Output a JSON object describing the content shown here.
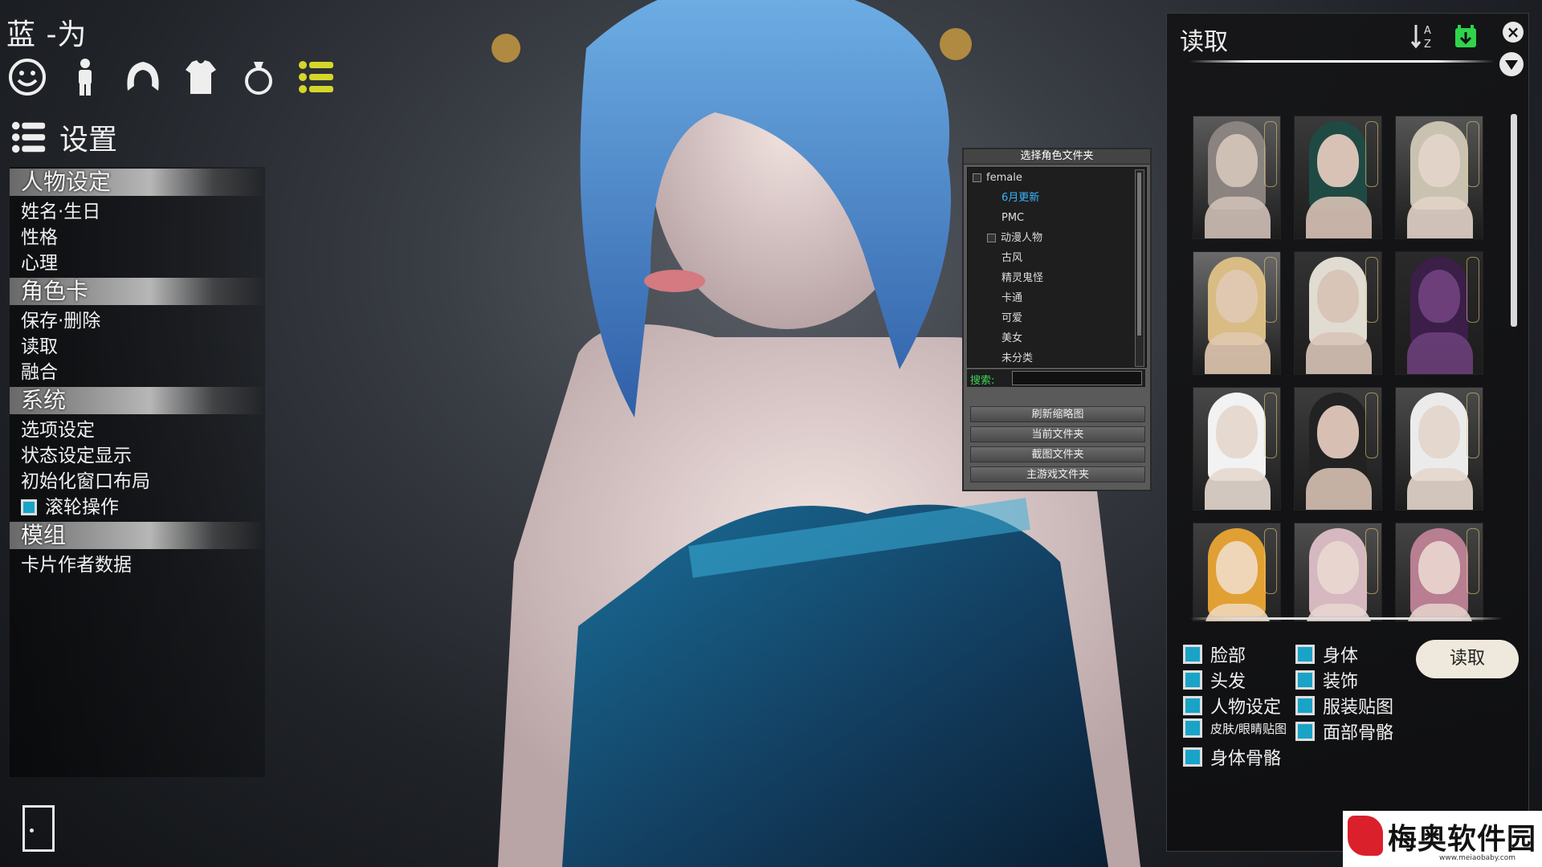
{
  "header": {
    "character_name": "蓝 -为",
    "categories": [
      {
        "name": "face-icon"
      },
      {
        "name": "body-icon"
      },
      {
        "name": "hair-icon"
      },
      {
        "name": "clothes-icon"
      },
      {
        "name": "accessory-icon"
      },
      {
        "name": "list-menu-icon",
        "active_color": "#d6d62a"
      }
    ],
    "settings_label": "设置"
  },
  "left_menu": {
    "sections": [
      {
        "title": "人物设定",
        "items": [
          "姓名·生日",
          "性格",
          "心理"
        ]
      },
      {
        "title": "角色卡",
        "items": [
          "保存·删除",
          "读取",
          "融合"
        ]
      },
      {
        "title": "系统",
        "items": [
          "选项设定",
          "状态设定显示",
          "初始化窗口布局"
        ],
        "checkbox_item": "滚轮操作"
      },
      {
        "title": "模组",
        "items": [
          "卡片作者数据"
        ]
      }
    ]
  },
  "folder_panel": {
    "title": "选择角色文件夹",
    "tree": [
      {
        "label": "female",
        "indent": 0,
        "expander": true
      },
      {
        "label": "6月更新",
        "indent": 2,
        "active": true
      },
      {
        "label": "PMC",
        "indent": 2
      },
      {
        "label": "动漫人物",
        "indent": 1,
        "expander": true
      },
      {
        "label": "古风",
        "indent": 2
      },
      {
        "label": "精灵鬼怪",
        "indent": 2
      },
      {
        "label": "卡通",
        "indent": 2
      },
      {
        "label": "可爱",
        "indent": 2
      },
      {
        "label": "美女",
        "indent": 2
      },
      {
        "label": "未分类",
        "indent": 2
      }
    ],
    "search_label": "搜索:",
    "search_value": "",
    "buttons": [
      "刷新缩略图",
      "当前文件夹",
      "截图文件夹",
      "主游戏文件夹"
    ]
  },
  "load_panel": {
    "title": "读取",
    "sort_label": "A↓Z",
    "thumbnails": [
      {
        "skin": "#cfc0b6",
        "hair": "#8a8380",
        "bg": "#5a5a5a"
      },
      {
        "skin": "#d8c2b5",
        "hair": "#1f4a44",
        "bg": "#3a3a3a"
      },
      {
        "skin": "#e2d3c8",
        "hair": "#c9c2b0",
        "bg": "#555555"
      },
      {
        "skin": "#e0c8b0",
        "hair": "#d8bc84",
        "bg": "#6a6a6a"
      },
      {
        "skin": "#d9c4b8",
        "hair": "#e0dcd2",
        "bg": "#333333"
      },
      {
        "skin": "#6c3f7a",
        "hair": "#3b1f48",
        "bg": "#2a2a2a"
      },
      {
        "skin": "#e6d9d0",
        "hair": "#f2f2f2",
        "bg": "#484848"
      },
      {
        "skin": "#d7c0b3",
        "hair": "#222222",
        "bg": "#3c3c3c"
      },
      {
        "skin": "#e4d7cd",
        "hair": "#ebebeb",
        "bg": "#4a4a4a"
      },
      {
        "skin": "#efd6b8",
        "hair": "#e0a033",
        "bg": "#3f3f3f"
      },
      {
        "skin": "#e8d5cf",
        "hair": "#d6b8c0",
        "bg": "#4e4e4e"
      },
      {
        "skin": "#e6cfca",
        "hair": "#b87e92",
        "bg": "#444444"
      }
    ],
    "options_left": [
      "脸部",
      "头发",
      "人物设定",
      "皮肤/眼睛贴图",
      "身体骨骼"
    ],
    "options_right": [
      "身体",
      "装饰",
      "服装贴图",
      "面部骨骼"
    ],
    "read_button": "读取",
    "checkbox_color": "#19a3c7"
  },
  "watermark": {
    "text": "梅奥软件园",
    "url": "www.meiaobaby.com"
  }
}
